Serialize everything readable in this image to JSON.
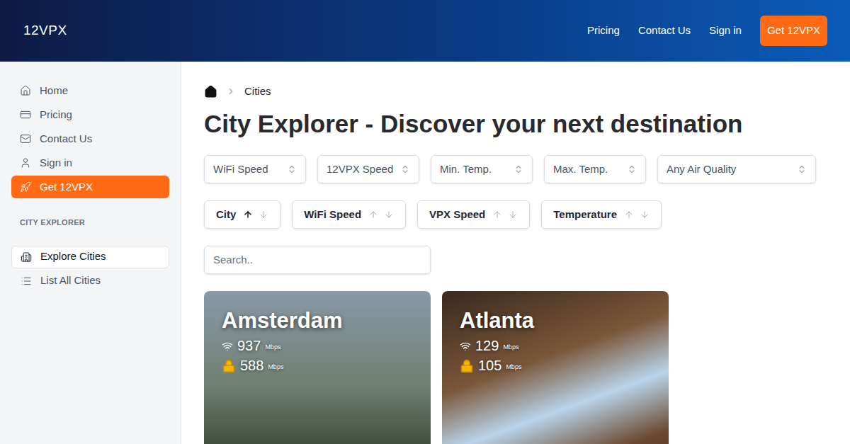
{
  "header": {
    "logo": "12VPX",
    "nav": [
      {
        "label": "Pricing",
        "kind": "link"
      },
      {
        "label": "Contact Us",
        "kind": "link"
      },
      {
        "label": "Sign in",
        "kind": "link"
      },
      {
        "label": "Get 12VPX",
        "kind": "button"
      }
    ]
  },
  "sidebar": {
    "items": [
      {
        "label": "Home",
        "highlighted": false
      },
      {
        "label": "Pricing",
        "highlighted": false
      },
      {
        "label": "Contact Us",
        "highlighted": false
      },
      {
        "label": "Sign in",
        "highlighted": false
      },
      {
        "label": "Get 12VPX",
        "highlighted": true
      }
    ],
    "section": {
      "title": "CITY EXPLORER",
      "items": [
        {
          "label": "Explore Cities",
          "selected": true
        },
        {
          "label": "List All Cities",
          "selected": false
        }
      ]
    }
  },
  "breadcrumb": {
    "current": "Cities"
  },
  "title": "City Explorer - Discover your next destination",
  "filters": [
    {
      "placeholder": "WiFi Speed"
    },
    {
      "placeholder": "12VPX Speed"
    },
    {
      "placeholder": "Min. Temp."
    },
    {
      "placeholder": "Max. Temp."
    },
    {
      "placeholder": "Any Air Quality"
    }
  ],
  "sorts": [
    {
      "label": "City",
      "up_active": true,
      "down_active": false
    },
    {
      "label": "WiFi Speed",
      "up_active": false,
      "down_active": false
    },
    {
      "label": "VPX Speed",
      "up_active": false,
      "down_active": false
    },
    {
      "label": "Temperature",
      "up_active": false,
      "down_active": false
    }
  ],
  "search": {
    "placeholder": "Search.."
  },
  "cities": [
    {
      "name": "Amsterdam",
      "wifi": "937",
      "vpx": "588",
      "unit": "Mbps"
    },
    {
      "name": "Atlanta",
      "wifi": "129",
      "vpx": "105",
      "unit": "Mbps"
    }
  ]
}
